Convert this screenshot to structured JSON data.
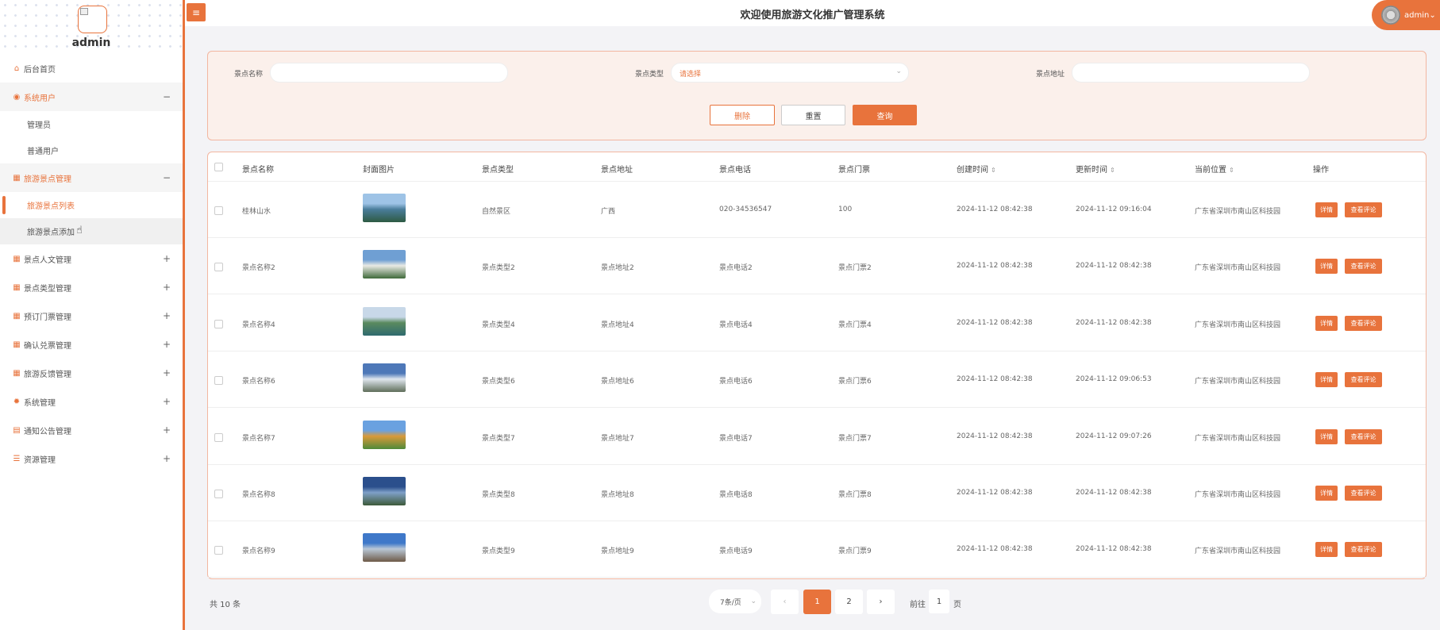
{
  "sidebar": {
    "username": "admin",
    "menu": [
      {
        "label": "后台首页",
        "icon": "home-icon",
        "toggle": ""
      },
      {
        "label": "系统用户",
        "icon": "user-circle-icon",
        "toggle": "−"
      },
      {
        "label": "管理员",
        "sub": true
      },
      {
        "label": "普通用户",
        "sub": true
      },
      {
        "label": "旅游景点管理",
        "icon": "grid-icon",
        "toggle": "−"
      },
      {
        "label": "旅游景点列表",
        "sub": true
      },
      {
        "label": "旅游景点添加",
        "sub": true
      },
      {
        "label": "景点人文管理",
        "icon": "grid-icon",
        "toggle": "+"
      },
      {
        "label": "景点类型管理",
        "icon": "grid-icon",
        "toggle": "+"
      },
      {
        "label": "预订门票管理",
        "icon": "grid-icon",
        "toggle": "+"
      },
      {
        "label": "确认兑票管理",
        "icon": "grid-icon",
        "toggle": "+"
      },
      {
        "label": "旅游反馈管理",
        "icon": "grid-icon",
        "toggle": "+"
      },
      {
        "label": "系统管理",
        "icon": "gear-icon",
        "toggle": "+"
      },
      {
        "label": "通知公告管理",
        "icon": "notice-icon",
        "toggle": "+"
      },
      {
        "label": "资源管理",
        "icon": "database-icon",
        "toggle": "+"
      }
    ]
  },
  "header": {
    "title": "欢迎使用旅游文化推广管理系统",
    "user": "admin",
    "menu_icon": "hamburger-icon"
  },
  "search": {
    "name_label": "景点名称",
    "name_value": "",
    "type_label": "景点类型",
    "type_placeholder": "请选择",
    "address_label": "景点地址",
    "address_value": "",
    "delete_label": "删除",
    "reset_label": "重置",
    "query_label": "查询"
  },
  "table": {
    "columns": [
      "景点名称",
      "封面图片",
      "景点类型",
      "景点地址",
      "景点电话",
      "景点门票",
      "创建时间",
      "更新时间",
      "当前位置",
      "操作"
    ],
    "rows": [
      {
        "name": "桂林山水",
        "type": "自然景区",
        "address": "广西",
        "phone": "020-34536547",
        "ticket": "100",
        "created": "2024-11-12 08:42:38",
        "updated": "2024-11-12 09:16:04",
        "location": "广东省深圳市南山区科技园",
        "img_colors": [
          "#9ec3e6",
          "#4a7d9b",
          "#2e5a43"
        ]
      },
      {
        "name": "景点名称2",
        "type": "景点类型2",
        "address": "景点地址2",
        "phone": "景点电话2",
        "ticket": "景点门票2",
        "created": "2024-11-12 08:42:38",
        "updated": "2024-11-12 08:42:38",
        "location": "广东省深圳市南山区科技园",
        "img_colors": [
          "#6f9fd3",
          "#e9e9e4",
          "#3f6a3a"
        ]
      },
      {
        "name": "景点名称4",
        "type": "景点类型4",
        "address": "景点地址4",
        "phone": "景点电话4",
        "ticket": "景点门票4",
        "created": "2024-11-12 08:42:38",
        "updated": "2024-11-12 08:42:38",
        "location": "广东省深圳市南山区科技园",
        "img_colors": [
          "#c8d8e8",
          "#5a8a5e",
          "#2f6a6e"
        ]
      },
      {
        "name": "景点名称6",
        "type": "景点类型6",
        "address": "景点地址6",
        "phone": "景点电话6",
        "ticket": "景点门票6",
        "created": "2024-11-12 08:42:38",
        "updated": "2024-11-12 09:06:53",
        "location": "广东省深圳市南山区科技园",
        "img_colors": [
          "#4e78b8",
          "#dfe6ee",
          "#5f6e5a"
        ]
      },
      {
        "name": "景点名称7",
        "type": "景点类型7",
        "address": "景点地址7",
        "phone": "景点电话7",
        "ticket": "景点门票7",
        "created": "2024-11-12 08:42:38",
        "updated": "2024-11-12 09:07:26",
        "location": "广东省深圳市南山区科技园",
        "img_colors": [
          "#6aa1e0",
          "#d99a3a",
          "#4f8a3a"
        ]
      },
      {
        "name": "景点名称8",
        "type": "景点类型8",
        "address": "景点地址8",
        "phone": "景点电话8",
        "ticket": "景点门票8",
        "created": "2024-11-12 08:42:38",
        "updated": "2024-11-12 08:42:38",
        "location": "广东省深圳市南山区科技园",
        "img_colors": [
          "#2b4f8c",
          "#7fa0c8",
          "#3d5a3a"
        ]
      },
      {
        "name": "景点名称9",
        "type": "景点类型9",
        "address": "景点地址9",
        "phone": "景点电话9",
        "ticket": "景点门票9",
        "created": "2024-11-12 08:42:38",
        "updated": "2024-11-12 08:42:38",
        "location": "广东省深圳市南山区科技园",
        "img_colors": [
          "#3f78c9",
          "#b9c7d6",
          "#6e5a48"
        ]
      }
    ],
    "detail_label": "详情",
    "review_label": "查看评论"
  },
  "pagination": {
    "total": "共 10 条",
    "page_size": "7条/页",
    "pages": [
      "1",
      "2"
    ],
    "current": "1",
    "goto_label": "前往",
    "goto_value": "1",
    "page_unit": "页"
  },
  "colors": {
    "accent": "#e8733c"
  }
}
